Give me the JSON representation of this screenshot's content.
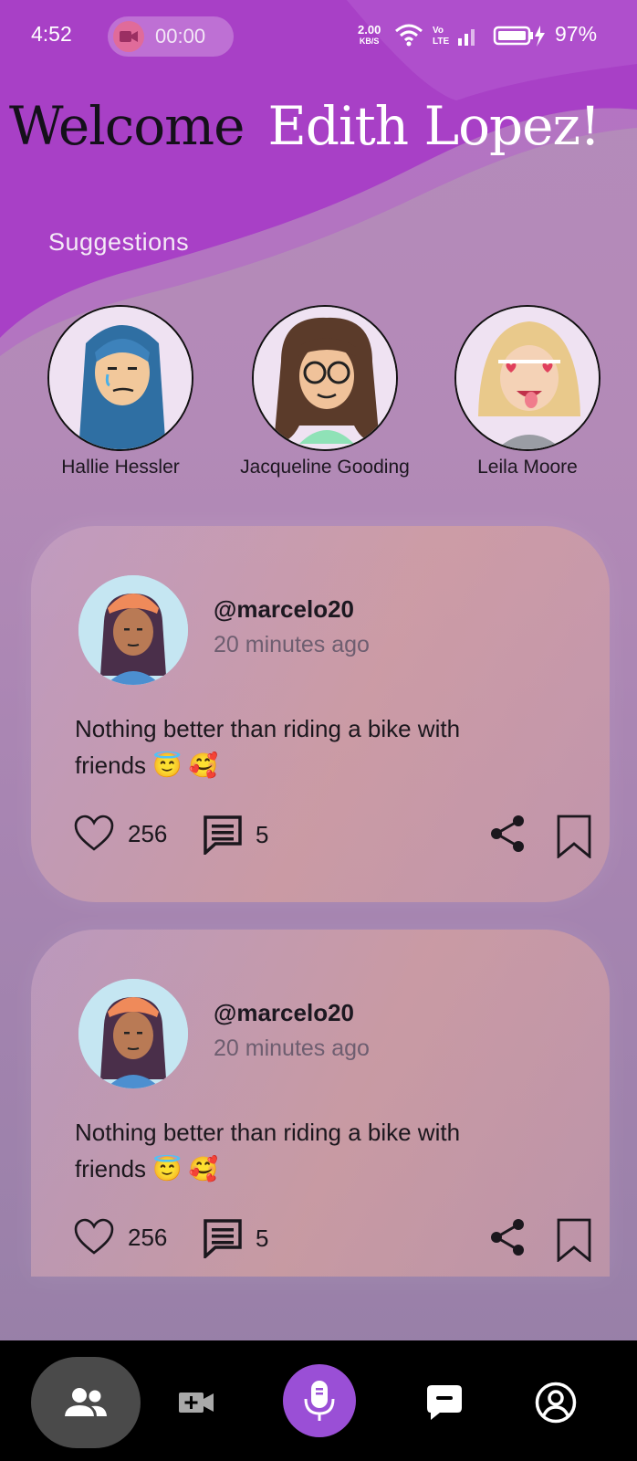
{
  "status_bar": {
    "time": "4:52",
    "recording_time": "00:00",
    "net_speed": "2.00",
    "net_unit": "KB/S",
    "battery": "97%"
  },
  "header": {
    "welcome": "Welcome",
    "user_name": "Edith Lopez!"
  },
  "suggestions": {
    "label": "Suggestions",
    "people": [
      {
        "name": "Hallie Hessler"
      },
      {
        "name": "Jacqueline Gooding"
      },
      {
        "name": "Leila Moore"
      }
    ]
  },
  "posts": [
    {
      "handle": "@marcelo20",
      "time_ago": "20 minutes ago",
      "line1": "Nothing better than riding a bike with",
      "line2": "friends 😇 🥰",
      "likes": "256",
      "comments": "5"
    },
    {
      "handle": "@marcelo20",
      "time_ago": "20 minutes ago",
      "line1": "Nothing better than riding a bike with",
      "line2": "friends 😇 🥰",
      "likes": "256",
      "comments": "5"
    }
  ],
  "nav": {
    "items": [
      "people-icon",
      "video-add-icon",
      "mic-icon",
      "chat-icon",
      "profile-icon"
    ],
    "accent": "#9a4fd6"
  }
}
